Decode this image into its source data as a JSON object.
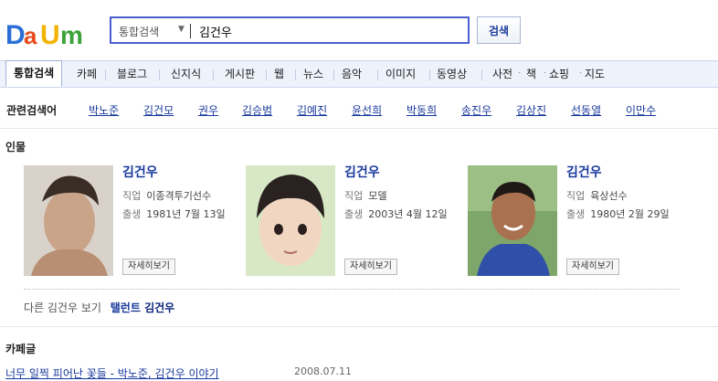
{
  "header": {
    "logo_text": "Daum",
    "search": {
      "category": "통합검색",
      "query": "김건우",
      "button": "검색"
    }
  },
  "tabs": [
    {
      "label": "통합검색",
      "active": true
    },
    {
      "label": "카페"
    },
    {
      "label": "블로그"
    },
    {
      "label": "신지식"
    },
    {
      "label": "게시판"
    },
    {
      "label": "웹"
    },
    {
      "label": "뉴스"
    },
    {
      "label": "음악"
    },
    {
      "label": "이미지"
    },
    {
      "label": "동영상"
    },
    {
      "label": "사전"
    },
    {
      "label": "책"
    },
    {
      "label": "쇼핑"
    },
    {
      "label": "지도"
    }
  ],
  "related": {
    "title": "관련검색어",
    "items": [
      "박노준",
      "김건모",
      "권우",
      "김승범",
      "김예진",
      "윤선희",
      "박동희",
      "송진우",
      "김상진",
      "선동열",
      "이만수"
    ]
  },
  "people": {
    "title": "인물",
    "cards": [
      {
        "name": "김건우",
        "job_label": "직업",
        "job": "이종격투기선수",
        "birth_label": "출생",
        "birth": "1981년 7월 13일",
        "detail": "자세히보기"
      },
      {
        "name": "김건우",
        "job_label": "직업",
        "job": "모델",
        "birth_label": "출생",
        "birth": "2003년 4월 12일",
        "detail": "자세히보기"
      },
      {
        "name": "김건우",
        "job_label": "직업",
        "job": "육상선수",
        "birth_label": "출생",
        "birth": "1980년 2월 29일",
        "detail": "자세히보기"
      }
    ],
    "other_label": "다른 김건우 보기",
    "other_prefix": "탤런트",
    "other_name": "김건우"
  },
  "cafe": {
    "title": "카페글",
    "first_post": "너무 일찍 피어난 꽃들 - 박노준, 김건우 이야기",
    "first_post_date": "2008.07.11"
  }
}
